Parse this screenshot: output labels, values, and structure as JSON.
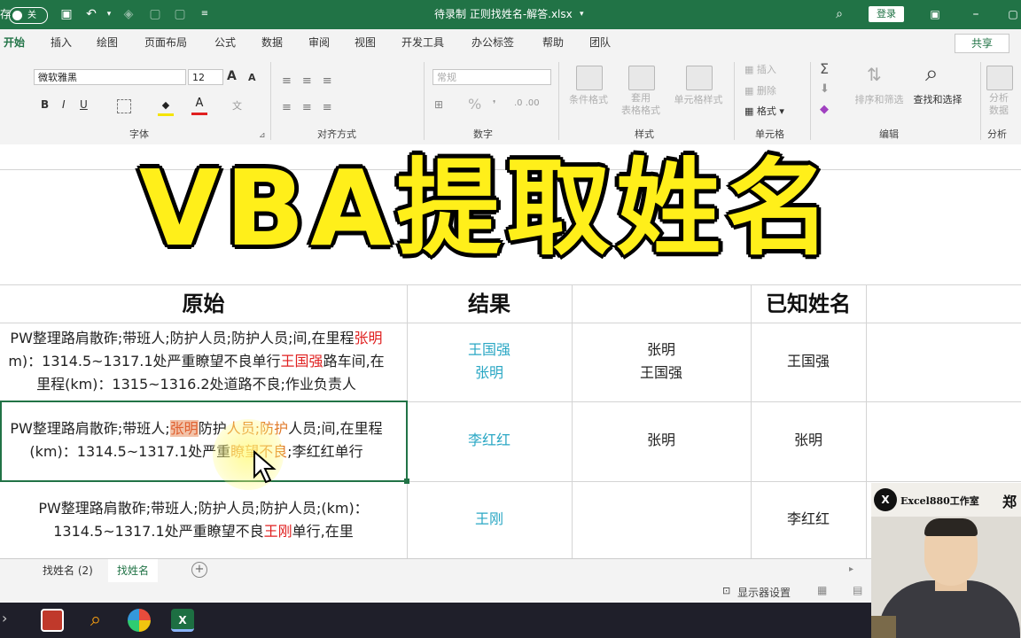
{
  "titlebar": {
    "autosave_label": "存",
    "toggle_state": "关",
    "filename": "待录制  正则找姓名-解答.xlsx",
    "login": "登录"
  },
  "ribbon_tabs": [
    {
      "label": "开始",
      "active": true
    },
    {
      "label": "插入"
    },
    {
      "label": "绘图"
    },
    {
      "label": "页面布局"
    },
    {
      "label": "公式"
    },
    {
      "label": "数据"
    },
    {
      "label": "审阅"
    },
    {
      "label": "视图"
    },
    {
      "label": "开发工具"
    },
    {
      "label": "办公标签"
    },
    {
      "label": "帮助"
    },
    {
      "label": "团队"
    }
  ],
  "share_label": "共享",
  "font_group": {
    "font_name": "微软雅黑",
    "font_size": "12",
    "bold": "B",
    "italic": "I",
    "underline": "U",
    "grow": "A",
    "shrink": "A",
    "label": "字体"
  },
  "align_group": {
    "label": "对齐方式"
  },
  "number_group": {
    "format": "常规",
    "label": "数字",
    "percent": "%"
  },
  "styles_group": {
    "cond_format": "条件格式",
    "table_format": "套用\n表格格式",
    "cell_style": "单元格样式",
    "label": "样式"
  },
  "cells_group": {
    "insert": "插入",
    "delete": "删除",
    "format": "格式",
    "label": "单元格"
  },
  "edit_group": {
    "sort": "排序和筛选",
    "find": "查找和选择",
    "label": "编辑"
  },
  "analysis_group": {
    "analyze": "分析\n数据",
    "label": "分析"
  },
  "overlay_title": "VBA提取姓名",
  "table": {
    "headers": {
      "original": "原始",
      "result": "结果",
      "known": "已知姓名"
    },
    "rows": [
      {
        "original_lines": [
          "PW整理路肩散砟;带班人;防护人员;防护人员;间,在里程",
          "张明",
          "m)：1314.5~1317.1处严重瞭望不良单行",
          "王国强",
          "路车间,在",
          "里程(km)：1315~1316.2处道路不良;作业负责人"
        ],
        "result": [
          "王国强",
          "张明"
        ],
        "col3": [
          "张明",
          "王国强"
        ],
        "known": "王国强"
      },
      {
        "original_lines": [
          "PW整理路肩散砟;带班人;",
          "张明",
          "防护",
          "人员;防护",
          "人员;间,在里程",
          "(km)：1314.5~1317.1处严重",
          "瞭望",
          "不良",
          ";李红红单行"
        ],
        "result": [
          "李红红"
        ],
        "col3": [
          "张明"
        ],
        "known": "张明"
      },
      {
        "original_lines": [
          "PW整理路肩散砟;带班人;防护人员;防护人员;(km)：",
          "1314.5~1317.1处严重瞭望不良",
          "王刚",
          "单行,在里"
        ],
        "result": [
          "王刚"
        ],
        "col3": [],
        "known": "李红红"
      }
    ]
  },
  "sheet_tabs": [
    {
      "label": "找姓名 (2)"
    },
    {
      "label": "找姓名",
      "active": true
    }
  ],
  "status": {
    "display_settings": "显示器设置"
  },
  "webcam": {
    "studio": "Excel880工作室",
    "name_partial": "郑"
  },
  "colors": {
    "excel_green": "#217346",
    "title_yellow": "#ffef1a",
    "name_cyan": "#2aa7c4",
    "name_red": "#e02020"
  }
}
